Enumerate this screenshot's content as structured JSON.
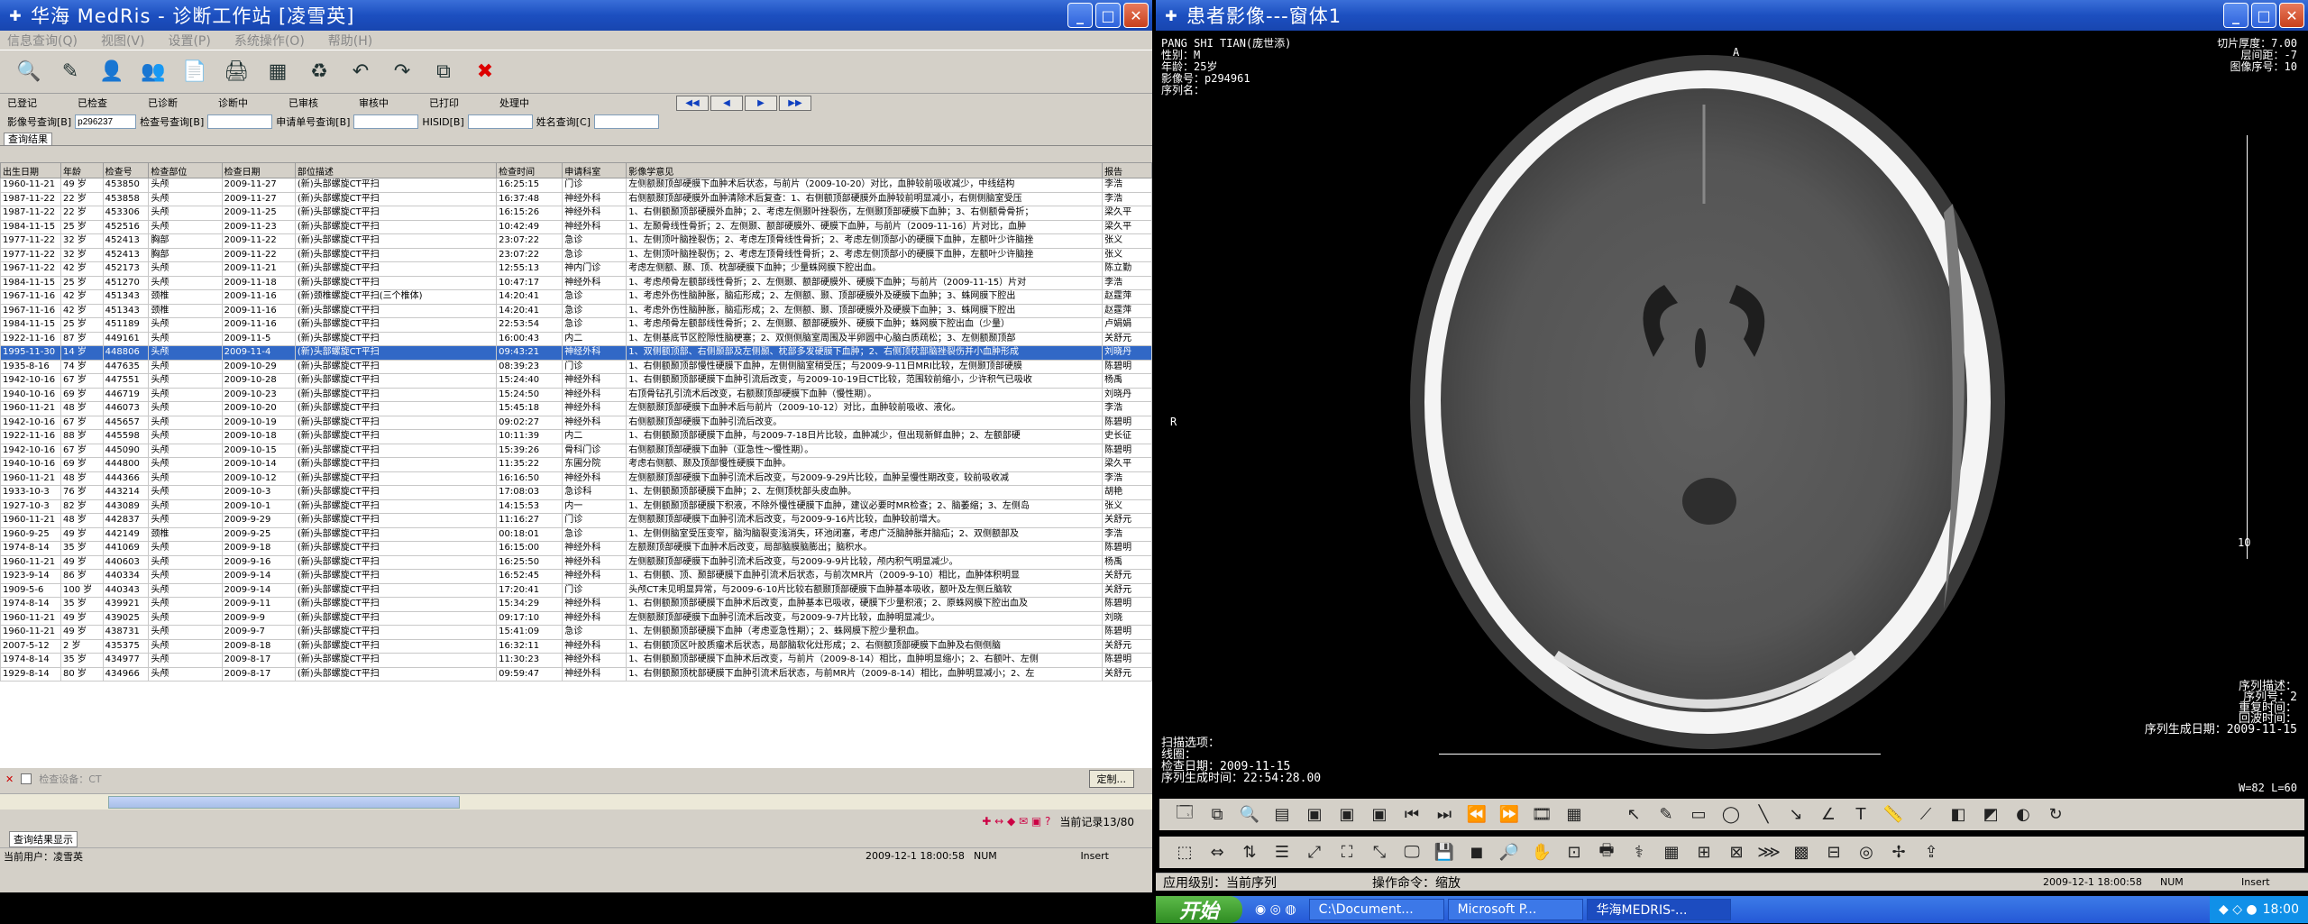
{
  "left": {
    "title": "华海 MedRis - 诊断工作站 [凌雪英]",
    "menu": [
      "信息查询(Q)",
      "视图(V)",
      "设置(P)",
      "系统操作(O)",
      "帮助(H)"
    ],
    "filters": [
      "已登记",
      "已检查",
      "已诊断",
      "诊断中",
      "已审核",
      "审核中",
      "已打印",
      "处理中"
    ],
    "search": {
      "img_label": "影像号查询[B]",
      "img_value": "p296237",
      "exam_label": "检查号查询[B]",
      "req_label": "申请单号查询[B]",
      "his_label": "HISID[B]",
      "name_label": "姓名查询[C]"
    },
    "tab": "查询结果",
    "columns": [
      "出生日期",
      "年龄",
      "检查号",
      "检查部位",
      "检查日期",
      "部位描述",
      "检查时间",
      "申请科室",
      "影像学意见",
      "报告"
    ],
    "rows": [
      [
        "1960-11-21",
        "49 岁",
        "453850",
        "头颅",
        "2009-11-27",
        "(新)头部螺旋CT平扫",
        "16:25:15",
        "门诊",
        "左侧额颞顶部硬膜下血肿术后状态，与前片（2009-10-20）对比，血肿较前吸收减少，中线结构",
        "李浩"
      ],
      [
        "1987-11-22",
        "22 岁",
        "453858",
        "头颅",
        "2009-11-27",
        "(新)头部螺旋CT平扫",
        "16:37:48",
        "神经外科",
        "右侧额颞顶部硬膜外血肿清除术后复查：1、右侧额顶部硬膜外血肿较前明显减小，右侧侧脑室受压",
        "李浩"
      ],
      [
        "1987-11-22",
        "22 岁",
        "453306",
        "头颅",
        "2009-11-25",
        "(新)头部螺旋CT平扫",
        "16:15:26",
        "神经外科",
        "1、右侧额颞顶部硬膜外血肿；2、考虑左侧颞叶挫裂伤，左侧颞顶部硬膜下血肿；3、右侧额骨骨折；",
        "梁久平"
      ],
      [
        "1984-11-15",
        "25 岁",
        "452516",
        "头颅",
        "2009-11-23",
        "(新)头部螺旋CT平扫",
        "10:42:49",
        "神经外科",
        "1、左颞骨线性骨折；2、左侧颞、额部硬膜外、硬膜下血肿，与前片（2009-11-16）片对比，血肿",
        "梁久平"
      ],
      [
        "1977-11-22",
        "32 岁",
        "452413",
        "胸部",
        "2009-11-22",
        "(新)头部螺旋CT平扫",
        "23:07:22",
        "急诊",
        "1、左侧顶叶脑挫裂伤；2、考虑左顶骨线性骨折；2、考虑左侧顶部小的硬膜下血肿，左额叶少许脑挫",
        "张义"
      ],
      [
        "1977-11-22",
        "32 岁",
        "452413",
        "胸部",
        "2009-11-22",
        "(新)头部螺旋CT平扫",
        "23:07:22",
        "急诊",
        "1、左侧顶叶脑挫裂伤；2、考虑左顶骨线性骨折；2、考虑左侧顶部小的硬膜下血肿，左额叶少许脑挫",
        "张义"
      ],
      [
        "1967-11-22",
        "42 岁",
        "452173",
        "头颅",
        "2009-11-21",
        "(新)头部螺旋CT平扫",
        "12:55:13",
        "神内门诊",
        "考虑左侧额、颞、顶、枕部硬膜下血肿；少量蛛网膜下腔出血。",
        "陈立勤"
      ],
      [
        "1984-11-15",
        "25 岁",
        "451270",
        "头颅",
        "2009-11-18",
        "(新)头部螺旋CT平扫",
        "10:47:17",
        "神经外科",
        "1、考虑颅骨左额部线性骨折；2、左侧颞、额部硬膜外、硬膜下血肿；与前片（2009-11-15）片对",
        "李浩"
      ],
      [
        "1967-11-16",
        "42 岁",
        "451343",
        "颈椎",
        "2009-11-16",
        "(新)颈椎螺旋CT平扫(三个椎体)",
        "14:20:41",
        "急诊",
        "1、考虑外伤性脑肿胀，脑疝形成；2、左侧额、颞、顶部硬膜外及硬膜下血肿；3、蛛网膜下腔出",
        "赵霆萍"
      ],
      [
        "1967-11-16",
        "42 岁",
        "451343",
        "颈椎",
        "2009-11-16",
        "(新)头部螺旋CT平扫",
        "14:20:41",
        "急诊",
        "1、考虑外伤性脑肿胀，脑疝形成；2、左侧额、颞、顶部硬膜外及硬膜下血肿；3、蛛网膜下腔出",
        "赵霆萍"
      ],
      [
        "1984-11-15",
        "25 岁",
        "451189",
        "头颅",
        "2009-11-16",
        "(新)头部螺旋CT平扫",
        "22:53:54",
        "急诊",
        "1、考虑颅骨左额部线性骨折；2、左侧颞、额部硬膜外、硬膜下血肿；蛛网膜下腔出血（少量）",
        "卢娟娟"
      ],
      [
        "1922-11-16",
        "87 岁",
        "449161",
        "头颅",
        "2009-11-5",
        "(新)头部螺旋CT平扫",
        "16:00:43",
        "内二",
        "1、左侧基底节区腔隙性脑梗塞；2、双侧侧脑室周围及半卵圆中心脑白质疏松；3、左侧额颞顶部",
        "关舒元"
      ],
      [
        "1995-11-30",
        "14 岁",
        "448806",
        "头颅",
        "2009-11-4",
        "(新)头部螺旋CT平扫",
        "09:43:21",
        "神经外科",
        "1、双侧额顶部、右侧颞部及左侧颞、枕部多发硬膜下血肿；2、右侧顶枕部脑挫裂伤并小血肿形成",
        "刘晓丹"
      ],
      [
        "1935-8-16",
        "74 岁",
        "447635",
        "头颅",
        "2009-10-29",
        "(新)头部螺旋CT平扫",
        "08:39:23",
        "门诊",
        "1、右侧额颞顶部慢性硬膜下血肿，左侧侧脑室稍受压；与2009-9-11日MRI比较，左侧颞顶部硬膜",
        "陈碧明"
      ],
      [
        "1942-10-16",
        "67 岁",
        "447551",
        "头颅",
        "2009-10-28",
        "(新)头部螺旋CT平扫",
        "15:24:40",
        "神经外科",
        "1、右侧额颞顶部硬膜下血肿引流后改变，与2009-10-19日CT比较，范围较前缩小，少许积气已吸收",
        "杨禹"
      ],
      [
        "1940-10-16",
        "69 岁",
        "446719",
        "头颅",
        "2009-10-23",
        "(新)头部螺旋CT平扫",
        "15:24:50",
        "神经外科",
        "右顶骨钻孔引流术后改变，右额颞顶部硬膜下血肿（慢性期）。",
        "刘晓丹"
      ],
      [
        "1960-11-21",
        "48 岁",
        "446073",
        "头颅",
        "2009-10-20",
        "(新)头部螺旋CT平扫",
        "15:45:18",
        "神经外科",
        "左侧额颞顶部硬膜下血肿术后与前片（2009-10-12）对比，血肿较前吸收、液化。",
        "李浩"
      ],
      [
        "1942-10-16",
        "67 岁",
        "445657",
        "头颅",
        "2009-10-19",
        "(新)头部螺旋CT平扫",
        "09:02:27",
        "神经外科",
        "右侧额颞顶部硬膜下血肿引流后改变。",
        "陈碧明"
      ],
      [
        "1922-11-16",
        "88 岁",
        "445598",
        "头颅",
        "2009-10-18",
        "(新)头部螺旋CT平扫",
        "10:11:39",
        "内二",
        "1、右侧额颞顶部硬膜下血肿，与2009-7-18日片比较，血肿减少，但出现新鲜血肿；2、左额部硬",
        "史长征"
      ],
      [
        "1942-10-16",
        "67 岁",
        "445090",
        "头颅",
        "2009-10-15",
        "(新)头部螺旋CT平扫",
        "15:39:26",
        "骨科门诊",
        "右侧额颞顶部硬膜下血肿（亚急性～慢性期）。",
        "陈碧明"
      ],
      [
        "1940-10-16",
        "69 岁",
        "444800",
        "头颅",
        "2009-10-14",
        "(新)头部螺旋CT平扫",
        "11:35:22",
        "东圃分院",
        "考虑右侧额、颞及顶部慢性硬膜下血肿。",
        "梁久平"
      ],
      [
        "1960-11-21",
        "48 岁",
        "444366",
        "头颅",
        "2009-10-12",
        "(新)头部螺旋CT平扫",
        "16:16:50",
        "神经外科",
        "左侧额颞顶部硬膜下血肿引流术后改变，与2009-9-29片比较，血肿呈慢性期改变，较前吸收减",
        "李浩"
      ],
      [
        "1933-10-3",
        "76 岁",
        "443214",
        "头颅",
        "2009-10-3",
        "(新)头部螺旋CT平扫",
        "17:08:03",
        "急诊科",
        "1、左侧额颞顶部硬膜下血肿；2、左侧顶枕部头皮血肿。",
        "胡艳"
      ],
      [
        "1927-10-3",
        "82 岁",
        "443089",
        "头颅",
        "2009-10-1",
        "(新)头部螺旋CT平扫",
        "14:15:53",
        "内一",
        "1、左侧额颞顶部硬膜下积液，不除外慢性硬膜下血肿，建议必要时MR检查；2、脑萎缩；3、左侧岛",
        "张义"
      ],
      [
        "1960-11-21",
        "48 岁",
        "442837",
        "头颅",
        "2009-9-29",
        "(新)头部螺旋CT平扫",
        "11:16:27",
        "门诊",
        "左侧额颞顶部硬膜下血肿引流术后改变，与2009-9-16片比较，血肿较前增大。",
        "关舒元"
      ],
      [
        "1960-9-25",
        "49 岁",
        "442149",
        "颈椎",
        "2009-9-25",
        "(新)头部螺旋CT平扫",
        "00:18:01",
        "急诊",
        "1、左侧侧脑室受压变窄，脑沟脑裂变浅消失，环池闭塞，考虑广泛脑肿胀并脑疝；2、双侧额部及",
        "李浩"
      ],
      [
        "1974-8-14",
        "35 岁",
        "441069",
        "头颅",
        "2009-9-18",
        "(新)头部螺旋CT平扫",
        "16:15:00",
        "神经外科",
        "左额颞顶部硬膜下血肿术后改变，局部脑膜脑膨出；脑积水。",
        "陈碧明"
      ],
      [
        "1960-11-21",
        "49 岁",
        "440603",
        "头颅",
        "2009-9-16",
        "(新)头部螺旋CT平扫",
        "16:25:50",
        "神经外科",
        "左侧额颞顶部硬膜下血肿引流术后改变，与2009-9-9片比较，颅内积气明显减少。",
        "杨禹"
      ],
      [
        "1923-9-14",
        "86 岁",
        "440334",
        "头颅",
        "2009-9-14",
        "(新)头部螺旋CT平扫",
        "16:52:45",
        "神经外科",
        "1、右侧额、顶、颞部硬膜下血肿引流术后状态，与前次MR片（2009-9-10）相比，血肿体积明显",
        "关舒元"
      ],
      [
        "1909-5-6",
        "100 岁",
        "440343",
        "头颅",
        "2009-9-14",
        "(新)头部螺旋CT平扫",
        "17:20:41",
        "门诊",
        "头颅CT未见明显异常，与2009-6-10片比较右额颞顶部硬膜下血肿基本吸收，额叶及左侧丘脑软",
        "关舒元"
      ],
      [
        "1974-8-14",
        "35 岁",
        "439921",
        "头颅",
        "2009-9-11",
        "(新)头部螺旋CT平扫",
        "15:34:29",
        "神经外科",
        "1、右侧额颞顶部硬膜下血肿术后改变，血肿基本已吸收，硬膜下少量积液；2、原蛛网膜下腔出血及",
        "陈碧明"
      ],
      [
        "1960-11-21",
        "49 岁",
        "439025",
        "头颅",
        "2009-9-9",
        "(新)头部螺旋CT平扫",
        "09:17:10",
        "神经外科",
        "左侧额颞顶部硬膜下血肿引流术后改变，与2009-9-7片比较，血肿明显减少。",
        "刘晓"
      ],
      [
        "1960-11-21",
        "49 岁",
        "438731",
        "头颅",
        "2009-9-7",
        "(新)头部螺旋CT平扫",
        "15:41:09",
        "急诊",
        "1、左侧额颞顶部硬膜下血肿（考虑亚急性期）；2、蛛网膜下腔少量积血。",
        "陈碧明"
      ],
      [
        "2007-5-12",
        "2 岁",
        "435375",
        "头颅",
        "2009-8-18",
        "(新)头部螺旋CT平扫",
        "16:32:11",
        "神经外科",
        "1、右侧额顶区叶胶质瘤术后状态，局部脑软化灶形成；2、右侧额顶部硬膜下血肿及右侧侧脑",
        "关舒元"
      ],
      [
        "1974-8-14",
        "35 岁",
        "434977",
        "头颅",
        "2009-8-17",
        "(新)头部螺旋CT平扫",
        "11:30:23",
        "神经外科",
        "1、右侧额颞顶部硬膜下血肿术后改变，与前片（2009-8-14）相比，血肿明显缩小；2、右额叶、左侧",
        "陈碧明"
      ],
      [
        "1929-8-14",
        "80 岁",
        "434966",
        "头颅",
        "2009-8-17",
        "(新)头部螺旋CT平扫",
        "09:59:47",
        "神经外科",
        "1、右侧额颞顶枕部硬膜下血肿引流术后状态，与前MR片（2009-8-14）相比，血肿明显减小；2、左",
        "关舒元"
      ]
    ],
    "selected_row": 12,
    "foot_label": "检查设备：CT",
    "custom_btn": "定制...",
    "record_info": "当前记录13/80",
    "bottom_tab": "查询结果显示",
    "status": {
      "user": "当前用户：凌雪英",
      "datetime": "2009-12-1 18:00:58",
      "num": "NUM",
      "insert": "Insert"
    }
  },
  "right": {
    "title": "患者影像---窗体1",
    "tl": "PANG SHI TIAN(庞世添)\n性别：M\n年龄：25岁\n影像号：p294961\n序列名：",
    "tr": "切片厚度：7.00\n层间距：-7\n图像序号：10",
    "top_marker": "A",
    "left_marker": "R",
    "scale_label": "10",
    "br": "序列描述：\n序列号：2\n重复时间：\n回波时间：\n序列生成日期：2009-11-15",
    "bl": "扫描选项：\n线圈：\n检查日期：2009-11-15\n序列生成时间：22:54:28.00",
    "wl": "W=82 L=60",
    "status": {
      "level": "应用级别：当前序列",
      "op": "操作命令：缩放",
      "datetime": "2009-12-1 18:00:58",
      "num": "NUM",
      "insert": "Insert"
    }
  },
  "taskbar": {
    "start": "开始",
    "items": [
      "C:\\Document...",
      "Microsoft P...",
      "华海MEDRIS-..."
    ],
    "time": "18:00"
  }
}
